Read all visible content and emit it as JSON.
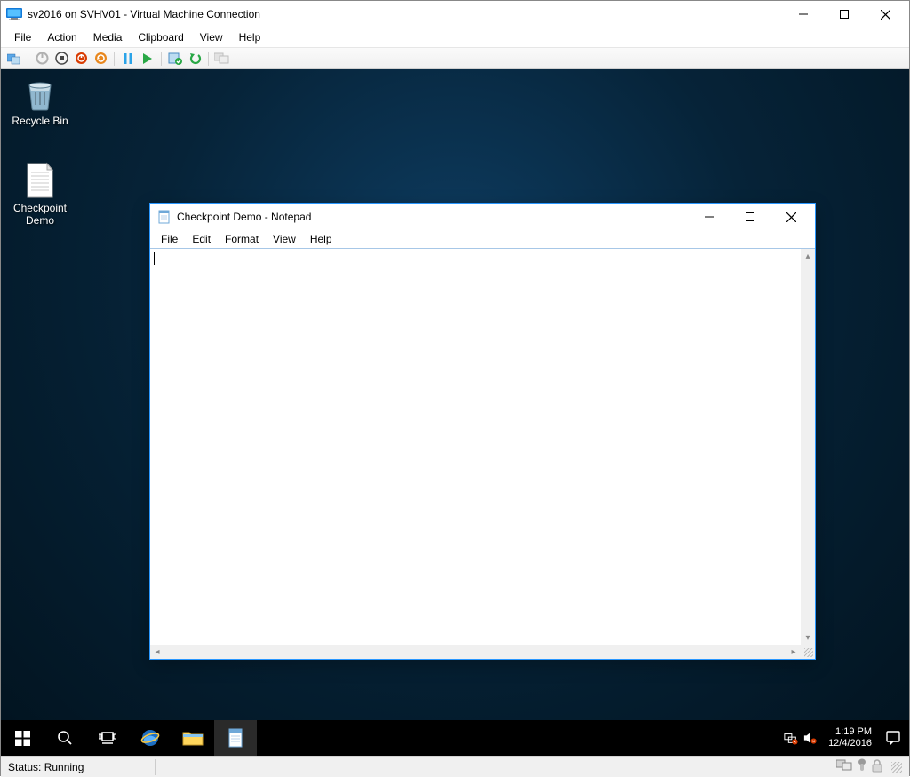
{
  "vm_window": {
    "title": "sv2016 on SVHV01 - Virtual Machine Connection",
    "menu": [
      "File",
      "Action",
      "Media",
      "Clipboard",
      "View",
      "Help"
    ],
    "toolbar_icons": [
      "ctrl-alt-del",
      "power-off",
      "stop",
      "shutdown",
      "reset",
      "pause",
      "start",
      "checkpoint",
      "revert",
      "enhanced-session"
    ]
  },
  "desktop": {
    "icons": [
      {
        "name": "recycle-bin",
        "label": "Recycle Bin"
      },
      {
        "name": "checkpoint-demo-file",
        "label": "Checkpoint\nDemo"
      }
    ]
  },
  "notepad": {
    "title": "Checkpoint Demo - Notepad",
    "menu": [
      "File",
      "Edit",
      "Format",
      "View",
      "Help"
    ],
    "content": ""
  },
  "taskbar": {
    "buttons": [
      "start",
      "search",
      "task-view",
      "internet-explorer",
      "file-explorer",
      "notepad"
    ],
    "tray_icons": [
      "network-warning",
      "volume-muted"
    ],
    "time": "1:19 PM",
    "date": "12/4/2016",
    "notifications_icon": "action-center"
  },
  "statusbar": {
    "text": "Status: Running",
    "icons": [
      "display-config",
      "usb-device",
      "lock"
    ]
  }
}
